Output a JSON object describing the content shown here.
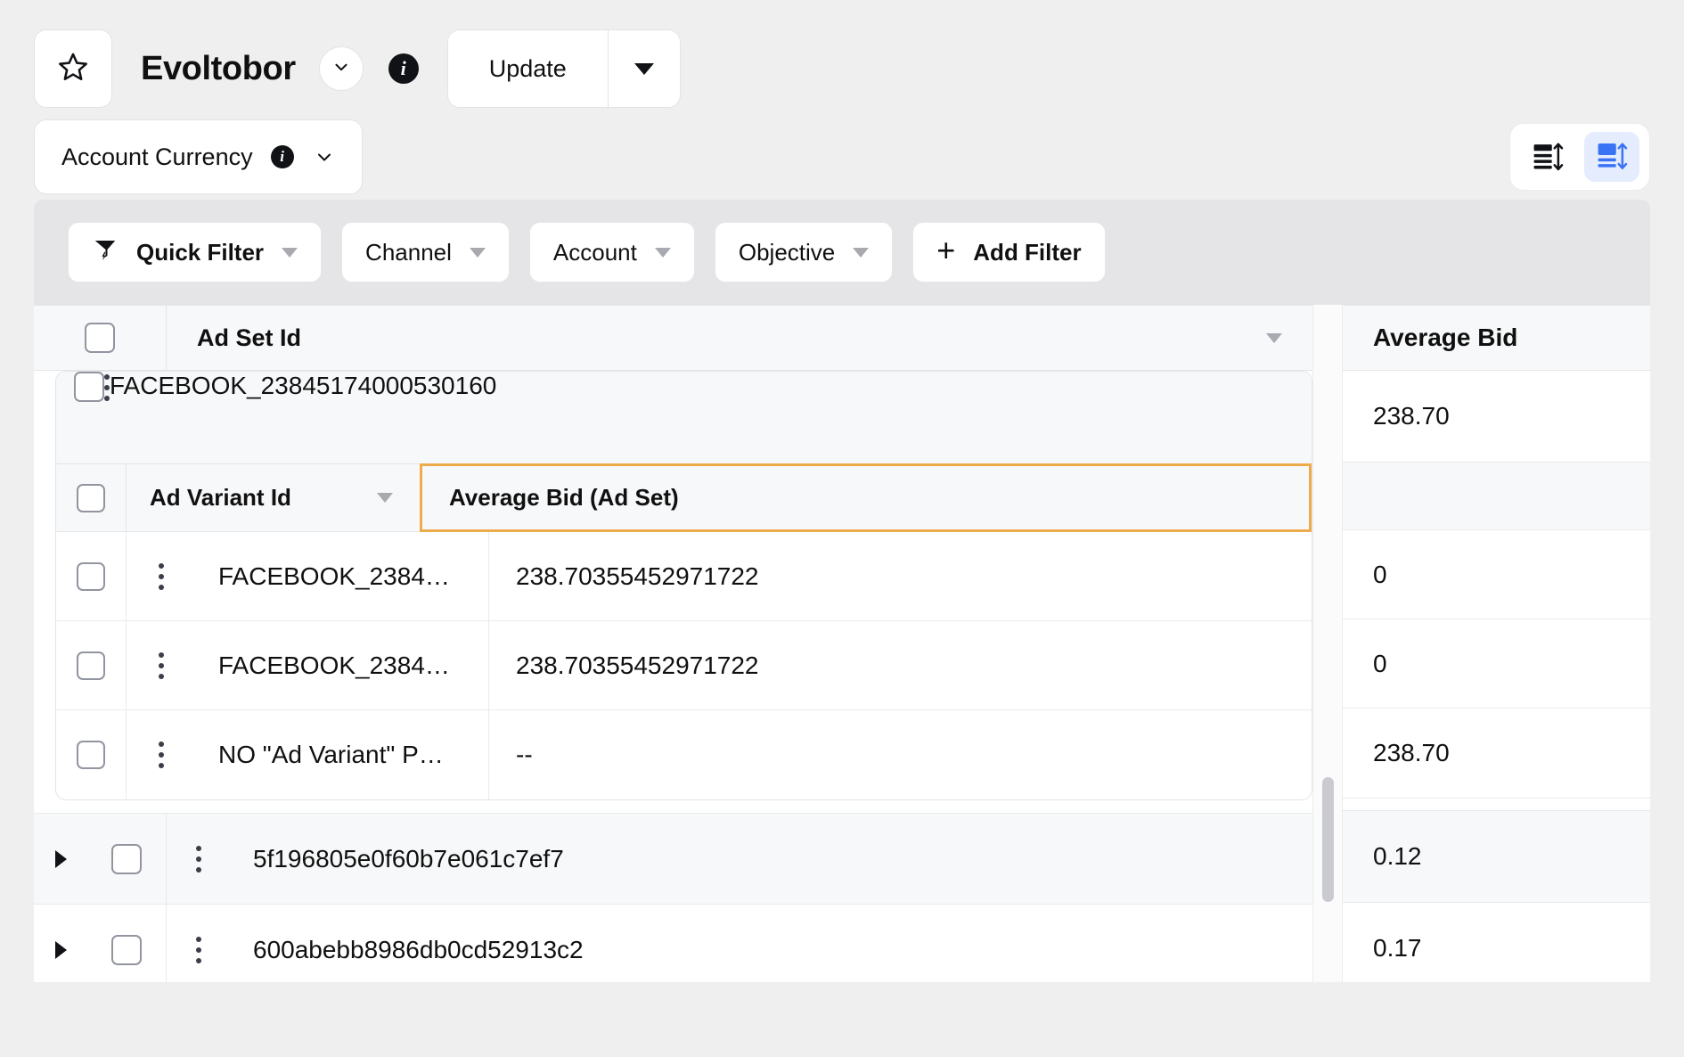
{
  "header": {
    "star_icon": "star-icon",
    "title": "Evoltobor",
    "title_caret_icon": "chevron-down-icon",
    "info_icon": "info-icon",
    "update_label": "Update",
    "update_caret_icon": "caret-down-icon"
  },
  "currency": {
    "label": "Account Currency",
    "info_icon": "info-icon",
    "caret_icon": "chevron-down-icon"
  },
  "view_toggle": {
    "compact_icon": "compact-rows-icon",
    "expanded_icon": "expanded-rows-icon",
    "active": "expanded",
    "active_color": "#3b73f5",
    "active_bg": "#e5ecfe"
  },
  "filters": {
    "quick_filter": {
      "label": "Quick Filter",
      "icon": "filter-bolt-icon",
      "caret_icon": "caret-down-icon"
    },
    "chips": [
      {
        "label": "Channel",
        "caret_icon": "caret-down-icon"
      },
      {
        "label": "Account",
        "caret_icon": "caret-down-icon"
      },
      {
        "label": "Objective",
        "caret_icon": "caret-down-icon"
      }
    ],
    "add_filter": {
      "label": "Add Filter",
      "icon": "plus-icon"
    }
  },
  "table": {
    "highlight_color": "#eeab4c",
    "columns": [
      {
        "key": "ad_set_id",
        "label": "Ad Set Id",
        "sort_icon": "caret-down-icon"
      },
      {
        "key": "average_bid",
        "label": "Average Bid"
      }
    ],
    "rows": [
      {
        "id": "FACEBOOK_23845174000530160",
        "average_bid": "238.70",
        "expanded": true,
        "expander_icon": "caret-down-icon",
        "kebab_icon": "more-vertical-icon",
        "sub_table": {
          "columns": [
            {
              "key": "ad_variant_id",
              "label": "Ad Variant Id",
              "sort_icon": "caret-down-icon"
            },
            {
              "key": "average_bid_ad_set",
              "label": "Average Bid (Ad Set)",
              "highlighted": true
            }
          ],
          "rows": [
            {
              "ad_variant_id": "FACEBOOK_2384…",
              "average_bid_ad_set": "238.70355452971722",
              "average_bid": "0",
              "kebab_icon": "more-vertical-icon"
            },
            {
              "ad_variant_id": "FACEBOOK_2384…",
              "average_bid_ad_set": "238.70355452971722",
              "average_bid": "0",
              "kebab_icon": "more-vertical-icon"
            },
            {
              "ad_variant_id": "NO \"Ad Variant\" P…",
              "average_bid_ad_set": "--",
              "average_bid": "238.70",
              "kebab_icon": "more-vertical-icon"
            }
          ]
        }
      },
      {
        "id": "5f196805e0f60b7e061c7ef7",
        "average_bid": "0.12",
        "expanded": false,
        "expander_icon": "caret-right-icon",
        "kebab_icon": "more-vertical-icon"
      },
      {
        "id": "600abebb8986db0cd52913c2",
        "average_bid": "0.17",
        "expanded": false,
        "expander_icon": "caret-right-icon",
        "kebab_icon": "more-vertical-icon"
      }
    ]
  }
}
